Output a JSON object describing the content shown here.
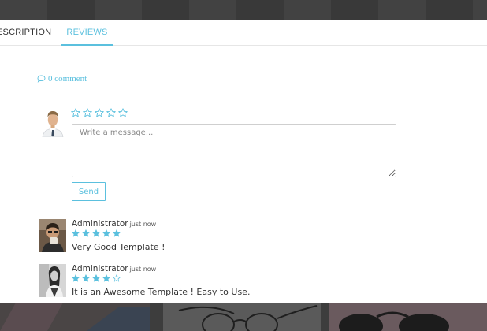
{
  "tabs": [
    {
      "label": "ESCRIPTION",
      "active": false
    },
    {
      "label": "REVIEWS",
      "active": true
    }
  ],
  "comments": {
    "icon": "comment-icon",
    "count_label": "0 comment"
  },
  "form": {
    "rating_stars": 5,
    "rating_value": 0,
    "placeholder": "Write a message...",
    "send_label": "Send"
  },
  "reviews": [
    {
      "author": "Administrator",
      "time": "just now",
      "rating": 5,
      "text": "Very Good Template !"
    },
    {
      "author": "Administrator",
      "time": "just now",
      "rating": 4,
      "text": "It is an Awesome Template ! Easy to Use."
    }
  ],
  "colors": {
    "accent": "#5bc0de",
    "dark_band": "#3c3c3c",
    "text": "#333333"
  }
}
